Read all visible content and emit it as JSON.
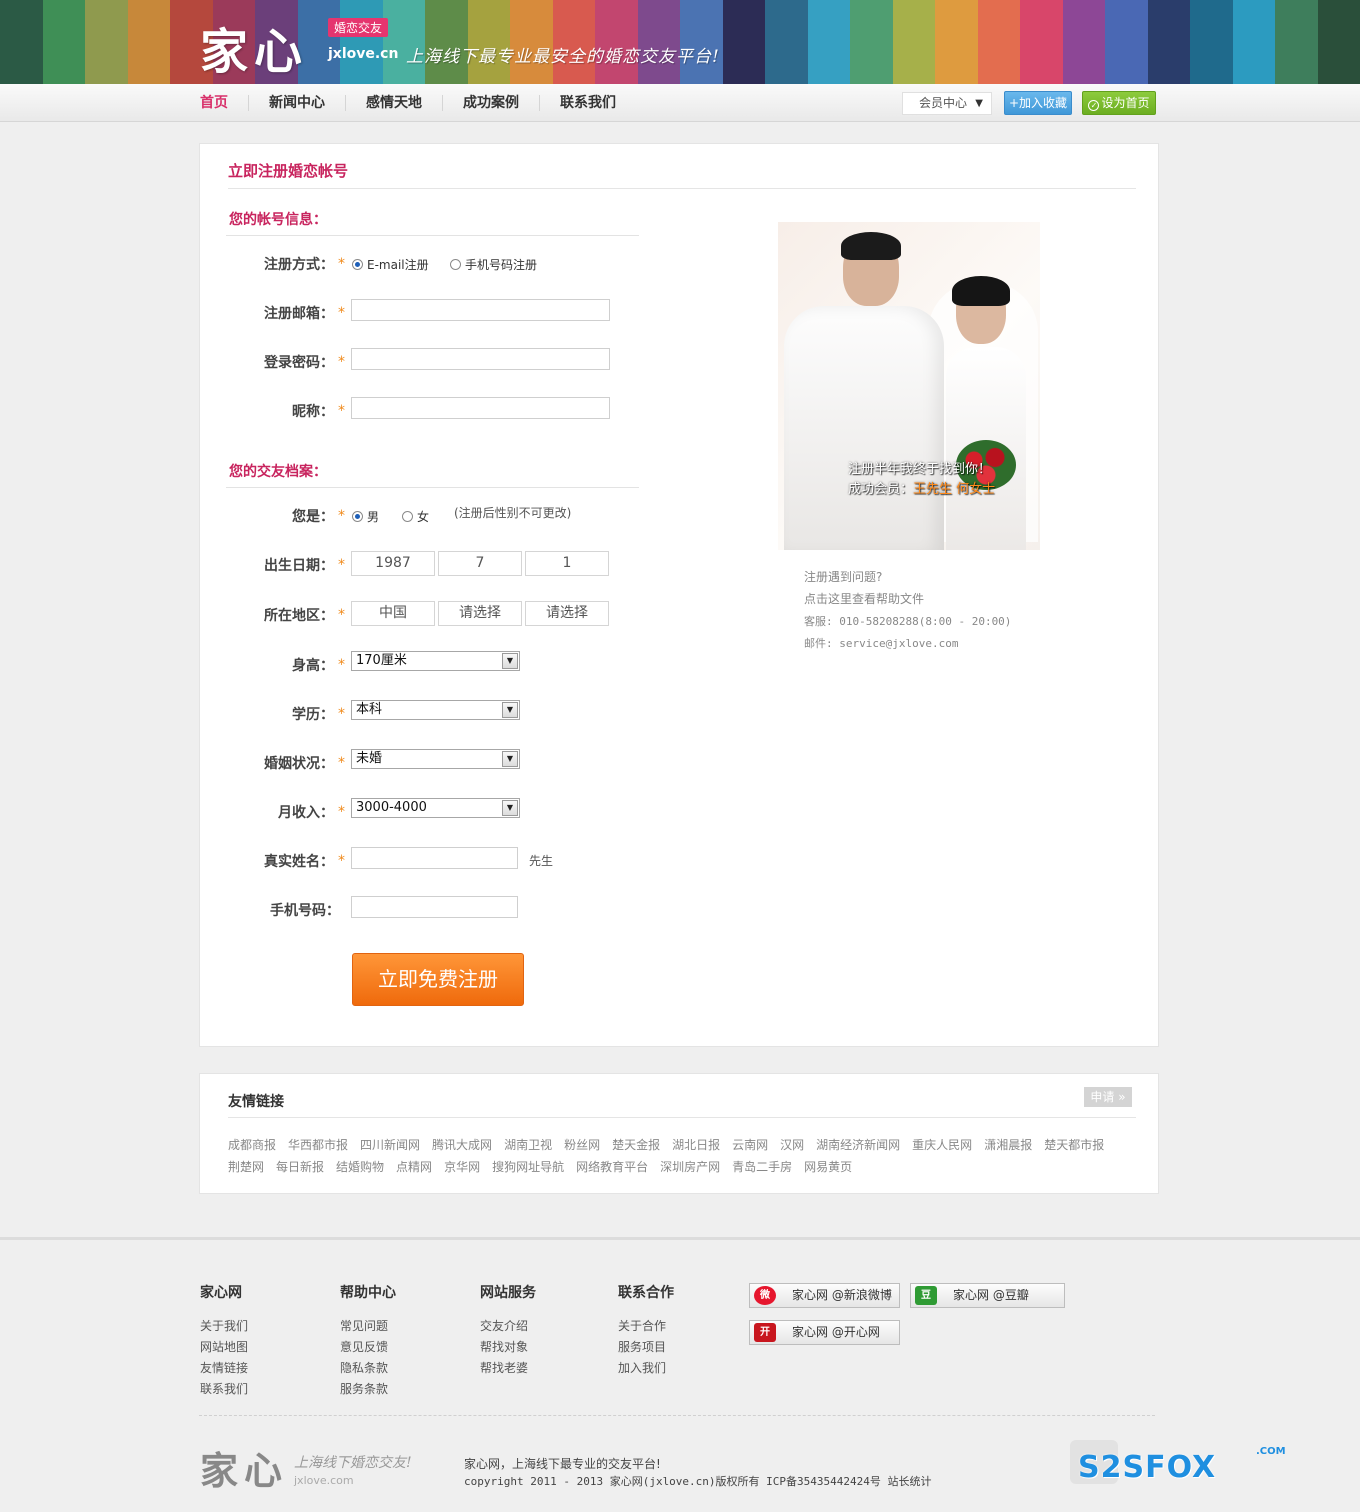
{
  "header": {
    "logo_text": "家心",
    "badge": "婚恋交友",
    "domain": "jxlove.cn",
    "slogan": "上海线下最专业最安全的婚恋交友平台!",
    "stripe_colors": [
      "#2b5a45",
      "#3f8f56",
      "#8f9a4e",
      "#c7883a",
      "#b5483d",
      "#9b3a5a",
      "#6b3f7a",
      "#3c6fa6",
      "#2e9ab5",
      "#4ab0a0",
      "#5e8c49",
      "#a5a23f",
      "#d78b3c",
      "#d85a4f",
      "#c2466f",
      "#7e4a8d",
      "#4b73b2",
      "#2c2c55",
      "#2d6a8c",
      "#36a0c2",
      "#4f9e71",
      "#a6b04a",
      "#de9b3f",
      "#e36d4f",
      "#d8466a",
      "#8d4796",
      "#4a68b4",
      "#2a3d6b",
      "#1f6a8c",
      "#2c9bc0",
      "#3e7e5c",
      "#2a4f3a"
    ]
  },
  "nav": {
    "items": [
      "首页",
      "新闻中心",
      "感情天地",
      "成功案例",
      "联系我们"
    ],
    "member_center": "会员中心",
    "add_favorite": "+加入收藏",
    "set_home": "设为首页"
  },
  "register": {
    "title": "立即注册婚恋帐号",
    "account_section": "您的帐号信息：",
    "profile_section": "您的交友档案：",
    "labels": {
      "method": "注册方式：",
      "email": "注册邮箱：",
      "password": "登录密码：",
      "nickname": "昵称：",
      "gender": "您是：",
      "birth": "出生日期：",
      "region": "所在地区：",
      "height": "身高：",
      "education": "学历：",
      "marital": "婚姻状况：",
      "income": "月收入：",
      "realname": "真实姓名：",
      "mobile": "手机号码："
    },
    "required_mark": "*",
    "method_options": [
      "E-mail注册",
      "手机号码注册"
    ],
    "method_selected": "E-mail注册",
    "gender_options": [
      "男",
      "女"
    ],
    "gender_selected": "男",
    "gender_note": "(注册后性别不可更改)",
    "birth": {
      "year": "1987",
      "month": "7",
      "day": "1"
    },
    "region": {
      "country": "中国",
      "province": "请选择",
      "city": "请选择"
    },
    "height_value": "170厘米",
    "education_value": "本科",
    "marital_value": "未婚",
    "income_value": "3000-4000",
    "realname_suffix": "先生",
    "submit": "立即免费注册"
  },
  "promo": {
    "caption_line1": "注册半年我终于找到你！",
    "caption_prefix": "成功会员：",
    "caption_names": "王先生  何女士",
    "help_lines": [
      "注册遇到问题?",
      "点击这里查看帮助文件",
      "客服: 010-58208288(8:00 - 20:00)",
      "邮件: service@jxlove.com"
    ]
  },
  "friend_links": {
    "title": "友情链接",
    "apply": "申请 »",
    "row1": [
      "成都商报",
      "华西都市报",
      "四川新闻网",
      "腾讯大成网",
      "湖南卫视",
      "粉丝网",
      "楚天金报",
      "湖北日报",
      "云南网",
      "汉网",
      "湖南经济新闻网",
      "重庆人民网",
      "潇湘晨报",
      "楚天都市报"
    ],
    "row2": [
      "荆楚网",
      "每日新报",
      "结婚购物",
      "点精网",
      "京华网",
      "搜狗网址导航",
      "网络教育平台",
      "深圳房产网",
      "青岛二手房",
      "网易黄页"
    ]
  },
  "footer": {
    "columns": [
      {
        "title": "家心网",
        "items": [
          "关于我们",
          "网站地图",
          "友情链接",
          "联系我们"
        ]
      },
      {
        "title": "帮助中心",
        "items": [
          "常见问题",
          "意见反馈",
          "隐私条款",
          "服务条款"
        ]
      },
      {
        "title": "网站服务",
        "items": [
          "交友介绍",
          "帮找对象",
          "帮找老婆"
        ]
      },
      {
        "title": "联系合作",
        "items": [
          "关于合作",
          "服务项目",
          "加入我们"
        ]
      }
    ],
    "social": [
      "家心网 @新浪微博",
      "家心网 @豆瓣",
      "家心网 @开心网"
    ],
    "logo": "家心",
    "slogan": "上海线下婚恋交友!",
    "domain": "jxlove.com",
    "tagline": "家心网，上海线下最专业的交友平台!",
    "copyright": "copyright 2011 - 2013 家心网(jxlove.cn)版权所有  ICP备35435442424号 站长统计",
    "watermark": "S2SFOX",
    "watermark_suffix": ".COM"
  }
}
